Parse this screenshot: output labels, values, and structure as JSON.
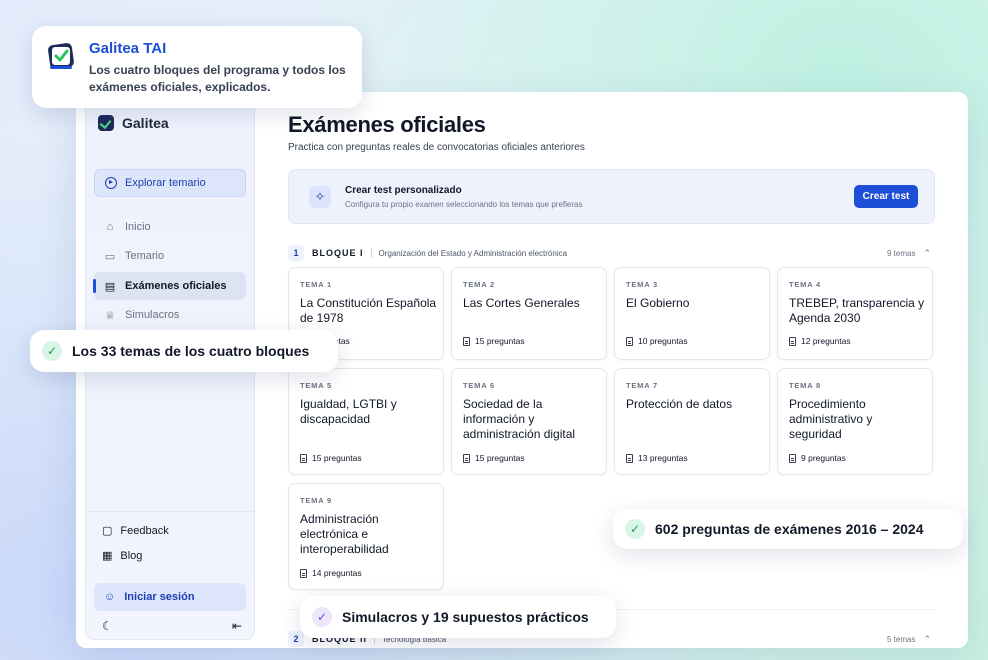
{
  "sidebar": {
    "brand": "Galitea",
    "explore": "Explorar temario",
    "items": [
      {
        "label": "Inicio"
      },
      {
        "label": "Temario"
      },
      {
        "label": "Exámenes oficiales"
      },
      {
        "label": "Simulacros"
      }
    ],
    "footer": {
      "feedback": "Feedback",
      "blog": "Blog",
      "login": "Iniciar sesión"
    }
  },
  "main": {
    "title": "Exámenes oficiales",
    "subtitle": "Practica con preguntas reales de convocatorias oficiales anteriores",
    "custom": {
      "title": "Crear test personalizado",
      "description": "Configura tu propio examen seleccionando los temas que prefieras",
      "button": "Crear test"
    },
    "blocks": [
      {
        "num": "1",
        "label": "BLOQUE I",
        "desc": "Organización del Estado y Administración electrónica",
        "count": "9 temas"
      },
      {
        "num": "2",
        "label": "BLOQUE II",
        "desc": "Tecnología básica",
        "count": "5 temas"
      }
    ],
    "cards": [
      {
        "num": "TEMA 1",
        "name": "La Constitución Española de 1978",
        "q": "preguntas"
      },
      {
        "num": "TEMA 2",
        "name": "Las Cortes Generales",
        "q": "15 preguntas"
      },
      {
        "num": "TEMA 3",
        "name": "El Gobierno",
        "q": "10 preguntas"
      },
      {
        "num": "TEMA 4",
        "name": "TREBEP, transparencia y Agenda 2030",
        "q": "12 preguntas"
      },
      {
        "num": "TEMA 5",
        "name": "Igualdad, LGTBI y discapacidad",
        "q": "15 preguntas"
      },
      {
        "num": "TEMA 6",
        "name": "Sociedad de la información y administración digital",
        "q": "15 preguntas"
      },
      {
        "num": "TEMA 7",
        "name": "Protección de datos",
        "q": "13 preguntas"
      },
      {
        "num": "TEMA 8",
        "name": "Procedimiento administrativo y seguridad",
        "q": "9 preguntas"
      },
      {
        "num": "TEMA 9",
        "name": "Administración electrónica e interoperabilidad",
        "q": "14 preguntas"
      }
    ]
  },
  "callouts": {
    "tai_title": "Galitea TAI",
    "tai_desc": "Los cuatro bloques del programa y todos los exámenes oficiales, explicados.",
    "topics": "Los 33 temas de los cuatro bloques",
    "questions": "602 preguntas de exámenes 2016 – 2024",
    "sims": "Simulacros y 19 supuestos prácticos"
  },
  "icons": {
    "check": "check-icon",
    "sparkle": "sparkle-icon",
    "moon": "moon-icon",
    "collapse": "collapse-sidebar-icon"
  },
  "colors": {
    "accent": "#1d4ed8",
    "success": "#16a34a",
    "purple": "#7c3aed"
  }
}
